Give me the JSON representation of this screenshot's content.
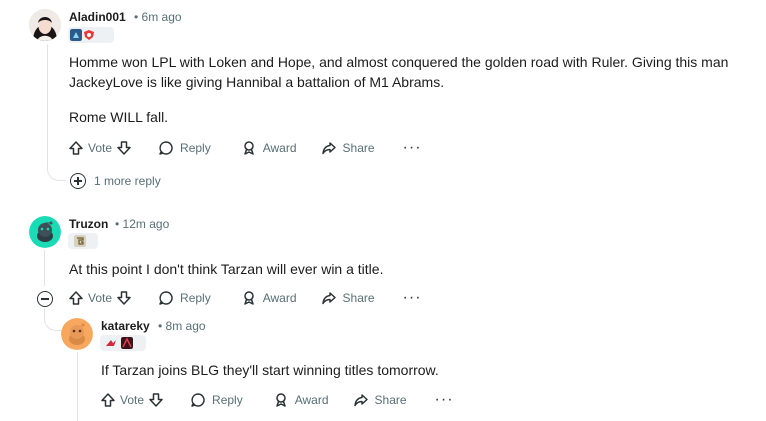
{
  "comments": [
    {
      "author": "Aladin001",
      "time": "6m ago",
      "flairs": [
        "lol-team-flair-icon",
        "red-shield-flair-icon"
      ],
      "paragraphs": [
        "Homme won LPL with Loken and Hope, and almost conquered the golden road with Ruler. Giving this man JackeyLove is like giving Hannibal a battalion of M1 Abrams.",
        "Rome WILL fall."
      ],
      "more_replies": "1 more reply"
    },
    {
      "author": "Truzon",
      "time": "12m ago",
      "flairs": [
        "gen-g-flair-icon"
      ],
      "paragraphs": [
        "At this point I don't think Tarzan will ever win a title."
      ]
    },
    {
      "author": "katareky",
      "time": "8m ago",
      "flairs": [
        "red-team-flair-icon",
        "champion-flair-icon"
      ],
      "paragraphs": [
        "If Tarzan joins BLG they'll start winning titles tomorrow."
      ]
    }
  ],
  "actions": {
    "vote": "Vote",
    "reply": "Reply",
    "award": "Award",
    "share": "Share",
    "more": "···"
  },
  "colors": {
    "text": "#1c1c1c",
    "meta": "#576f76",
    "thread_line": "#e1e4e7",
    "truzon_avatar_bg": "#19dbb5",
    "katareky_avatar_bg": "#f7a85e"
  }
}
